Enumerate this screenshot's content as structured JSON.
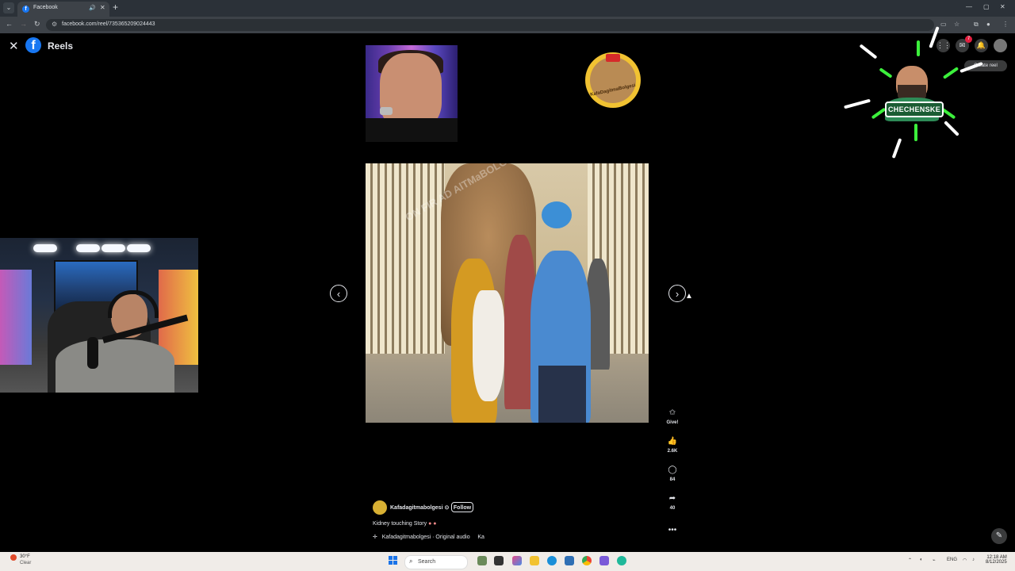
{
  "browser": {
    "tab_title": "Facebook",
    "tab_favicon": "f",
    "url": "facebook.com/reel/735365209024443"
  },
  "header": {
    "close_glyph": "✕",
    "logo_glyph": "f",
    "title": "Reels",
    "notification_count": "7",
    "create_reel_label": "Create reel"
  },
  "overlays": {
    "channel_logo_text": "KafaDagitmaBolgesi",
    "streamer_banner": "CHECHENSKE"
  },
  "reel": {
    "author": "Kafadagitmabolgesi",
    "verified_glyph": "⊙",
    "follow_label": "Follow",
    "caption": "Kidney touching Story",
    "caption_emoji": "● ●",
    "audio_prefix": "✛",
    "audio_label": "Kafadagitmabolgesi · Original audio",
    "audio_scroll": "Ka",
    "watermark": "ON FIR AD AlTMaBOLGESI",
    "actions": [
      {
        "icon": "gift-icon",
        "glyph": "✩",
        "label": "Give!"
      },
      {
        "icon": "like-icon",
        "glyph": "👍",
        "label": "2.6K"
      },
      {
        "icon": "comment-icon",
        "glyph": "◯",
        "label": "84"
      },
      {
        "icon": "share-icon",
        "glyph": "➦",
        "label": "40"
      },
      {
        "icon": "more-icon",
        "glyph": "•••",
        "label": ""
      }
    ]
  },
  "taskbar": {
    "temperature": "30°F",
    "condition": "Clear",
    "search_label": "Search",
    "language": "ENG",
    "time": "12:18 AM",
    "date": "8/12/2025"
  }
}
